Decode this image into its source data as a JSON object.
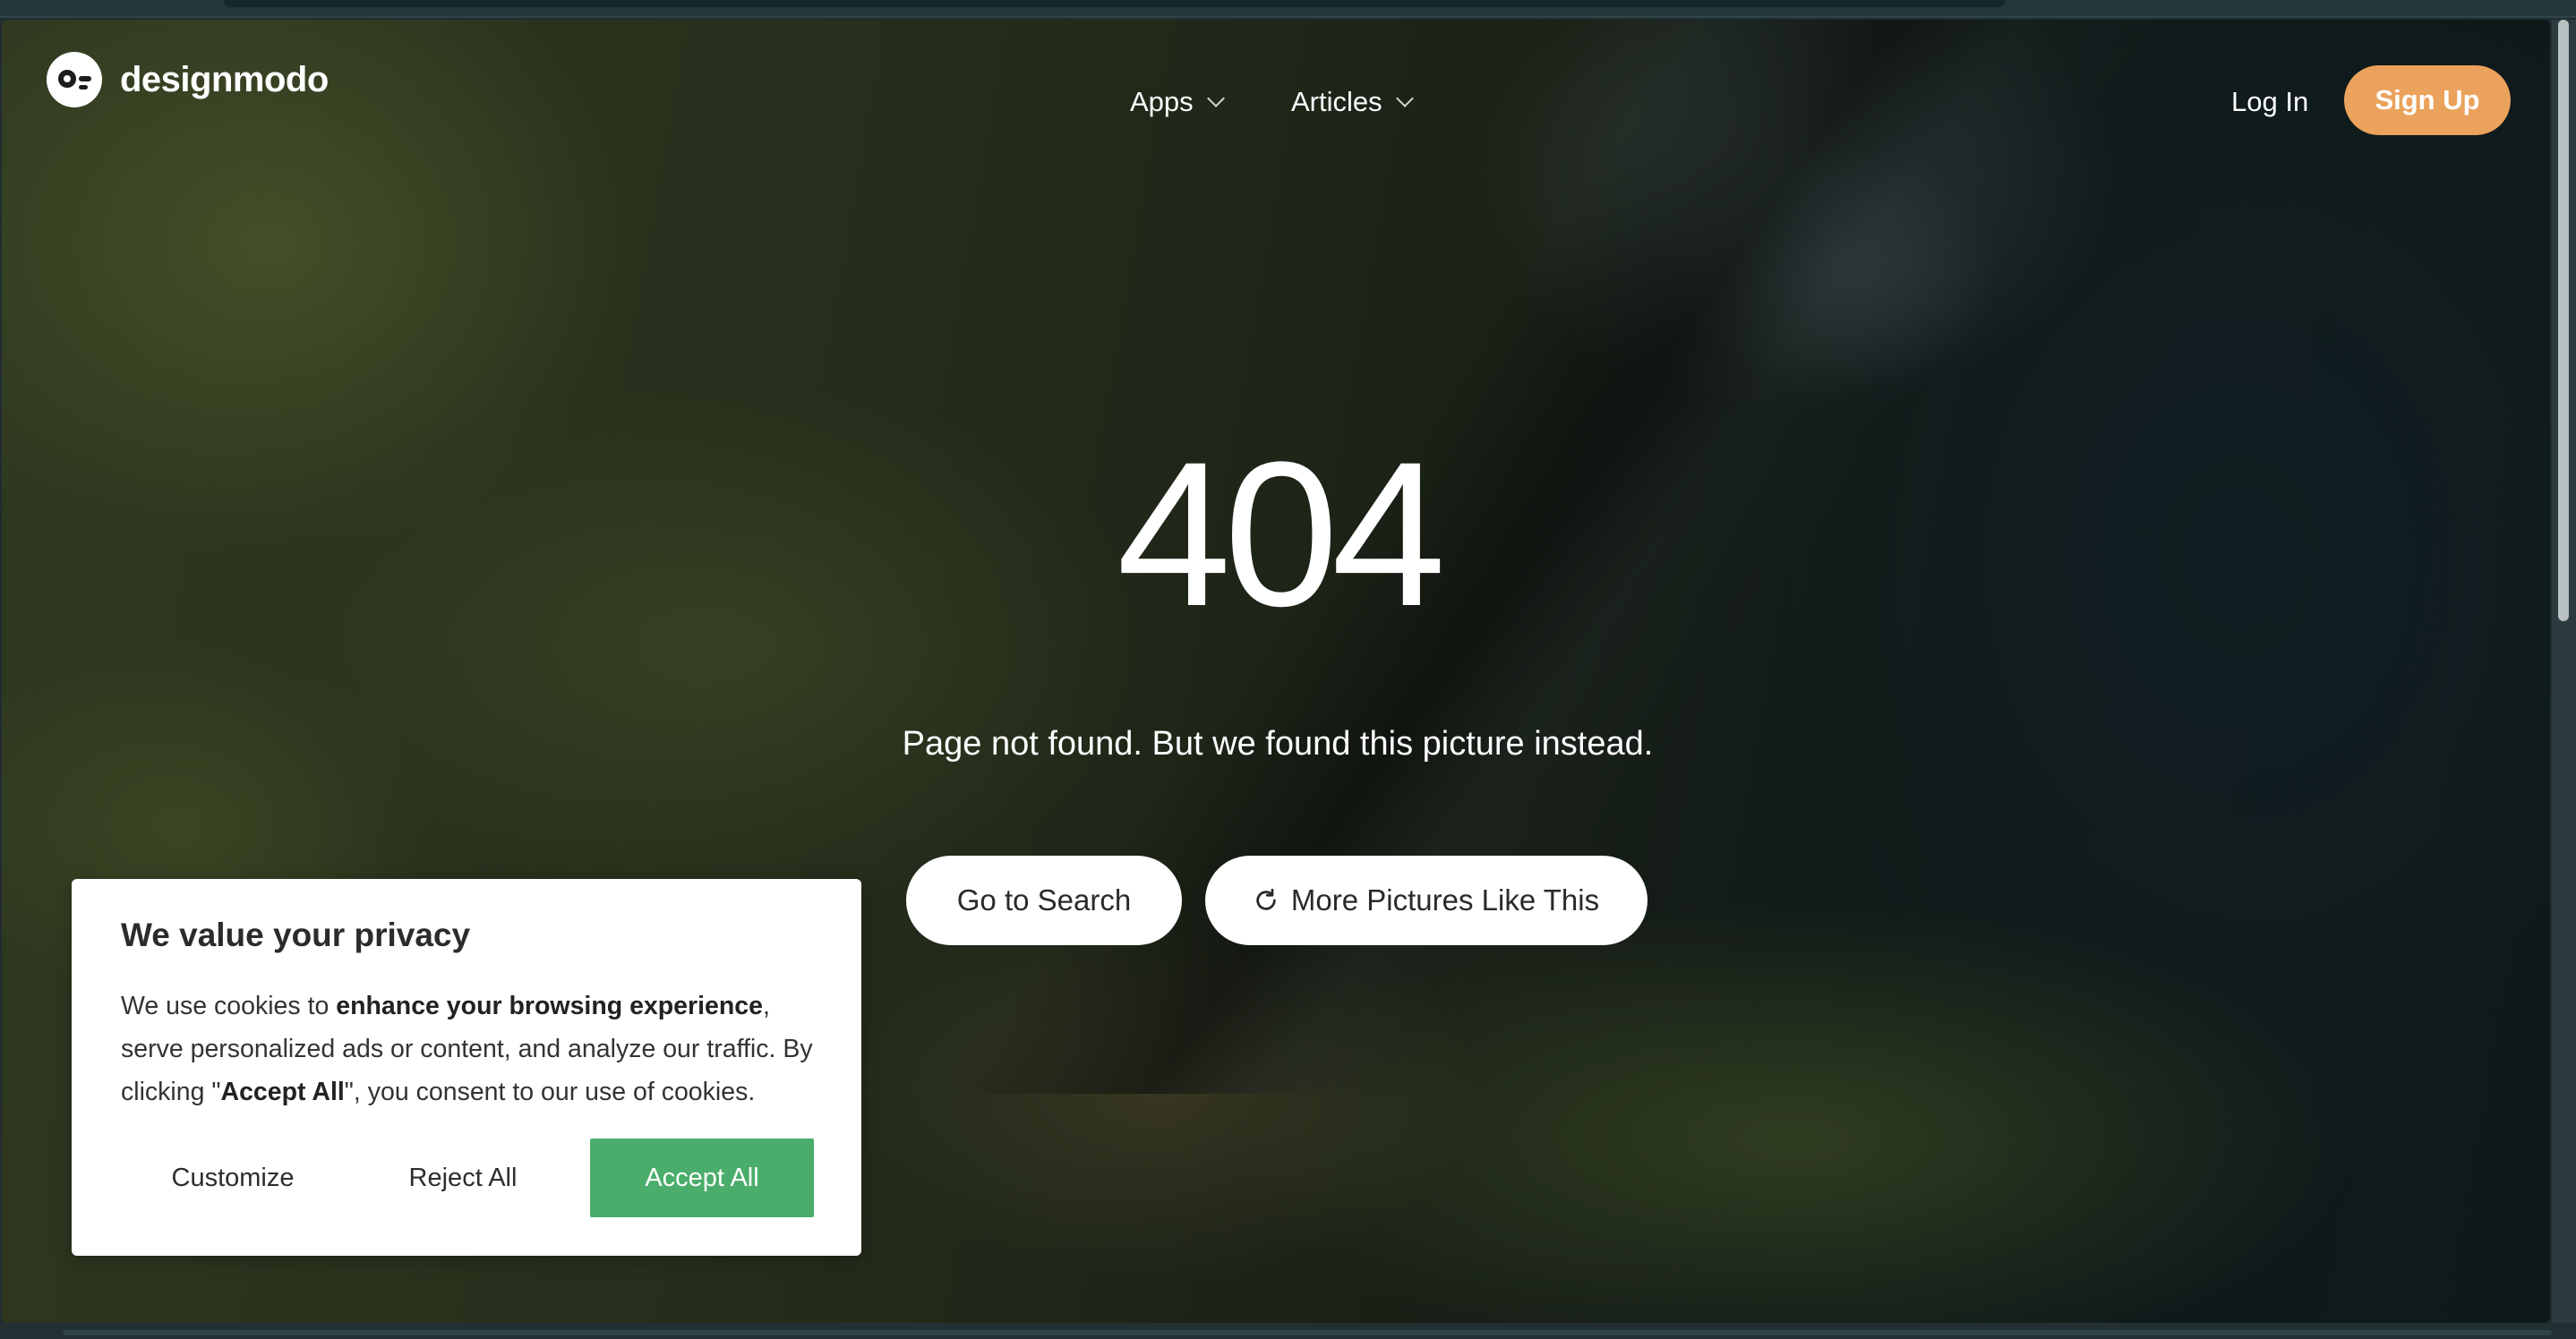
{
  "brand": {
    "logo_icon": "designmodo-logo-icon",
    "name": "designmodo"
  },
  "nav": {
    "apps_label": "Apps",
    "articles_label": "Articles",
    "login_label": "Log In",
    "signup_label": "Sign Up"
  },
  "hero": {
    "code": "404",
    "message": "Page not found. But we found this picture instead.",
    "search_button": "Go to Search",
    "more_button": "More Pictures Like This"
  },
  "cookie": {
    "title": "We value your privacy",
    "text_1": "We use cookies to ",
    "text_2": "enhance your browsing experience",
    "text_3": ", serve personalized ads or content, and analyze our traffic. By clicking \"",
    "text_4": "Accept All",
    "text_5": "\", you consent to our use of cookies.",
    "customize_label": "Customize",
    "reject_label": "Reject All",
    "accept_label": "Accept All"
  },
  "colors": {
    "signup_bg": "#eba25c",
    "accept_bg": "#4aad6b",
    "button_bg": "#ffffff"
  }
}
